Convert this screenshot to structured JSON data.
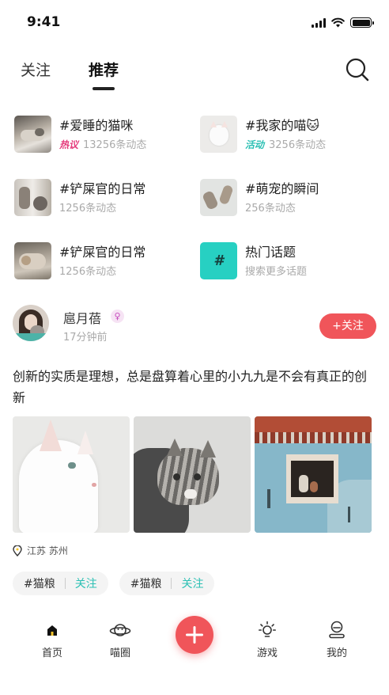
{
  "status": {
    "time": "9:41"
  },
  "tabs": [
    {
      "label": "关注",
      "active": false
    },
    {
      "label": "推荐",
      "active": true
    }
  ],
  "topics": [
    {
      "title": "#爱睡的猫咪",
      "tag": "热议",
      "sub": "13256条动态"
    },
    {
      "title": "#我家的喵🐱",
      "tag": "活动",
      "sub": "3256条动态"
    },
    {
      "title": "#铲屎官的日常",
      "tag": "",
      "sub": "1256条动态"
    },
    {
      "title": "#萌宠的瞬间",
      "tag": "",
      "sub": "256条动态"
    },
    {
      "title": "#铲屎官的日常",
      "tag": "",
      "sub": "1256条动态"
    },
    {
      "title": "热门话题",
      "tag": "",
      "sub": "搜索更多话题"
    }
  ],
  "post": {
    "username": "扈月蓓",
    "time": "17分钟前",
    "follow_label": "+关注",
    "text": "创新的实质是理想，总是盘算着心里的小九九是不会有真正的创新",
    "location": "江苏 苏州",
    "tags": [
      {
        "label": "#猫粮",
        "follow": "关注"
      },
      {
        "label": "#猫粮",
        "follow": "关注"
      }
    ]
  },
  "nav": [
    {
      "label": "首页",
      "icon": "home-icon",
      "active": true
    },
    {
      "label": "喵圈",
      "icon": "planet-icon",
      "active": false
    },
    {
      "label": "游戏",
      "icon": "bulb-icon",
      "active": false
    },
    {
      "label": "我的",
      "icon": "user-icon",
      "active": false
    }
  ],
  "colors": {
    "accent": "#f0555a",
    "teal": "#2cc0b4",
    "hot": "#e4397a"
  }
}
